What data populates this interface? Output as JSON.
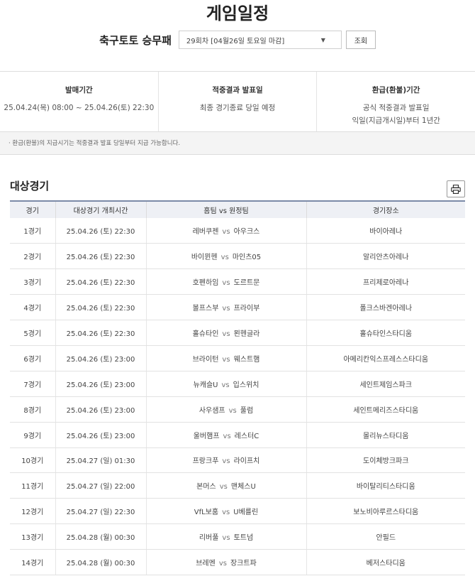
{
  "header": {
    "title": "게임일정"
  },
  "selector": {
    "game_name": "축구토토 승무패",
    "round_value": "29회차 [04월26일 토요일 마감]",
    "lookup_label": "조회"
  },
  "info": [
    {
      "label": "발매기간",
      "lines": [
        "25.04.24(목) 08:00 ~ 25.04.26(토) 22:30"
      ]
    },
    {
      "label": "적중결과 발표일",
      "lines": [
        "최종 경기종료 당일 예정"
      ]
    },
    {
      "label": "환급(환불)기간",
      "lines": [
        "공식 적중결과 발표일",
        "익일(지급개시일)부터 1년간"
      ]
    }
  ],
  "notice": "· 환급(환불)의 지급시기는 적중결과 발표 당일부터 지급 가능합니다.",
  "section": {
    "title": "대상경기"
  },
  "table": {
    "headers": [
      "경기",
      "대상경기 개최시간",
      "홈팀 vs 원정팀",
      "경기장소"
    ],
    "vs": "vs",
    "rows": [
      {
        "no": "1경기",
        "time": "25.04.26 (토) 22:30",
        "home": "레버쿠젠",
        "away": "아우크스",
        "venue": "바이아레나"
      },
      {
        "no": "2경기",
        "time": "25.04.26 (토) 22:30",
        "home": "바이뮌헨",
        "away": "마인츠05",
        "venue": "알리안츠아레나"
      },
      {
        "no": "3경기",
        "time": "25.04.26 (토) 22:30",
        "home": "호펜하임",
        "away": "도르트문",
        "venue": "프리제로아레나"
      },
      {
        "no": "4경기",
        "time": "25.04.26 (토) 22:30",
        "home": "볼프스부",
        "away": "프라이부",
        "venue": "폴크스바겐아레나"
      },
      {
        "no": "5경기",
        "time": "25.04.26 (토) 22:30",
        "home": "홀슈타인",
        "away": "묀헨글라",
        "venue": "홀슈타인스타디움"
      },
      {
        "no": "6경기",
        "time": "25.04.26 (토) 23:00",
        "home": "브라이턴",
        "away": "웨스트햄",
        "venue": "아메리칸익스프레스스타디움"
      },
      {
        "no": "7경기",
        "time": "25.04.26 (토) 23:00",
        "home": "뉴캐슬U",
        "away": "입스위치",
        "venue": "세인트제임스파크"
      },
      {
        "no": "8경기",
        "time": "25.04.26 (토) 23:00",
        "home": "사우샘프",
        "away": "풀럼",
        "venue": "세인트메리즈스타디움"
      },
      {
        "no": "9경기",
        "time": "25.04.26 (토) 23:00",
        "home": "울버햄프",
        "away": "레스터C",
        "venue": "몰리뉴스타디움"
      },
      {
        "no": "10경기",
        "time": "25.04.27 (일) 01:30",
        "home": "프랑크푸",
        "away": "라이프치",
        "venue": "도이체방크파크"
      },
      {
        "no": "11경기",
        "time": "25.04.27 (일) 22:00",
        "home": "본머스",
        "away": "맨체스U",
        "venue": "바이탈리티스타디움"
      },
      {
        "no": "12경기",
        "time": "25.04.27 (일) 22:30",
        "home": "VfL보훔",
        "away": "U베를린",
        "venue": "보노비아루르스타디움"
      },
      {
        "no": "13경기",
        "time": "25.04.28 (월) 00:30",
        "home": "리버풀",
        "away": "토트넘",
        "venue": "안필드"
      },
      {
        "no": "14경기",
        "time": "25.04.28 (월) 00:30",
        "home": "브레멘",
        "away": "장크트파",
        "venue": "베저스타디움"
      }
    ]
  }
}
